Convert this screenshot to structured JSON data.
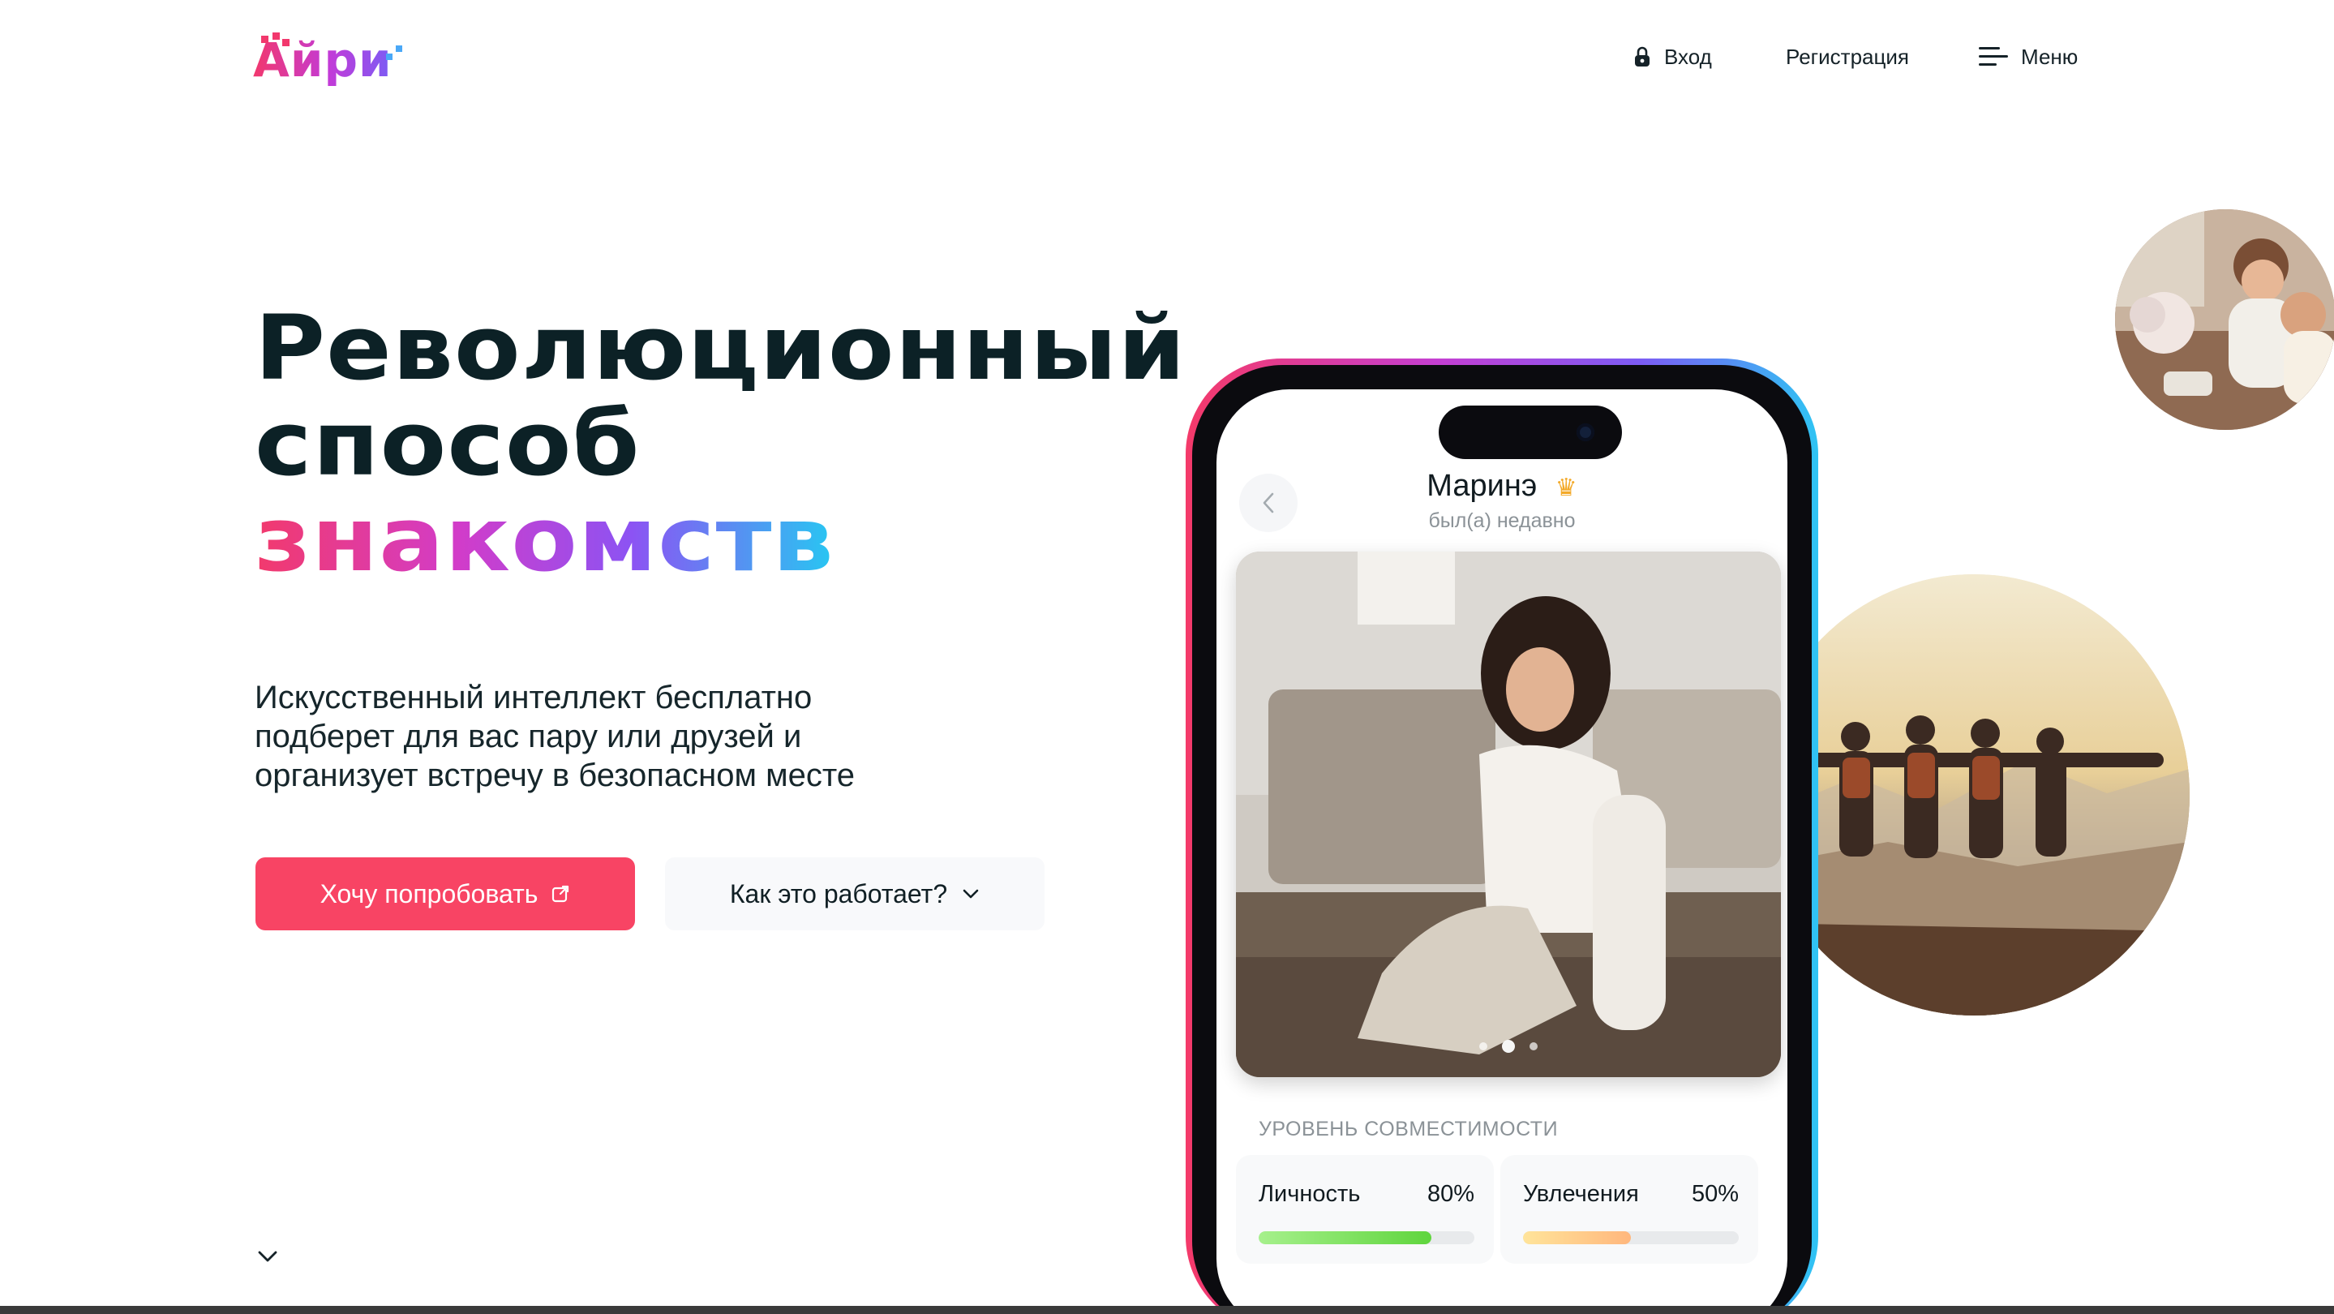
{
  "header": {
    "logo_text": "Айри",
    "nav": {
      "login": "Вход",
      "register": "Регистрация",
      "menu": "Меню"
    }
  },
  "hero": {
    "title_line1": "Революционный",
    "title_line2": "способ",
    "title_line3": "знакомств",
    "subtitle": "Искусственный интеллект бесплатно подберет для вас пару или друзей и организует встречу в безопасном месте",
    "primary_button": "Хочу попробовать",
    "secondary_button": "Как это работает?"
  },
  "phone": {
    "profile_name": "Маринэ",
    "profile_status": "был(а) недавно",
    "photo_dots": {
      "count": 3,
      "active_index": 1
    },
    "compatibility": {
      "title": "УРОВЕНЬ СОВМЕСТИМОСТИ",
      "items": [
        {
          "label": "Личность",
          "value": "80%",
          "fraction": 0.8
        },
        {
          "label": "Увлечения",
          "value": "50%",
          "fraction": 0.5
        }
      ]
    }
  },
  "colors": {
    "accent": "#f84464",
    "gradient": [
      "#f23a6c",
      "#d23cc9",
      "#8c53f3",
      "#27c7f2"
    ],
    "text_dark": "#0c2126",
    "text_muted": "#8b9297",
    "personality_bar": "#5fd53d",
    "hobbies_bar": "#ffb77d"
  },
  "icons": {
    "login": "lock-icon",
    "menu": "hamburger-menu-icon",
    "external": "external-link-icon",
    "dropdown": "chevron-down-icon",
    "back": "chevron-left-icon",
    "premium": "crown-icon",
    "scroll": "chevron-down-icon"
  }
}
